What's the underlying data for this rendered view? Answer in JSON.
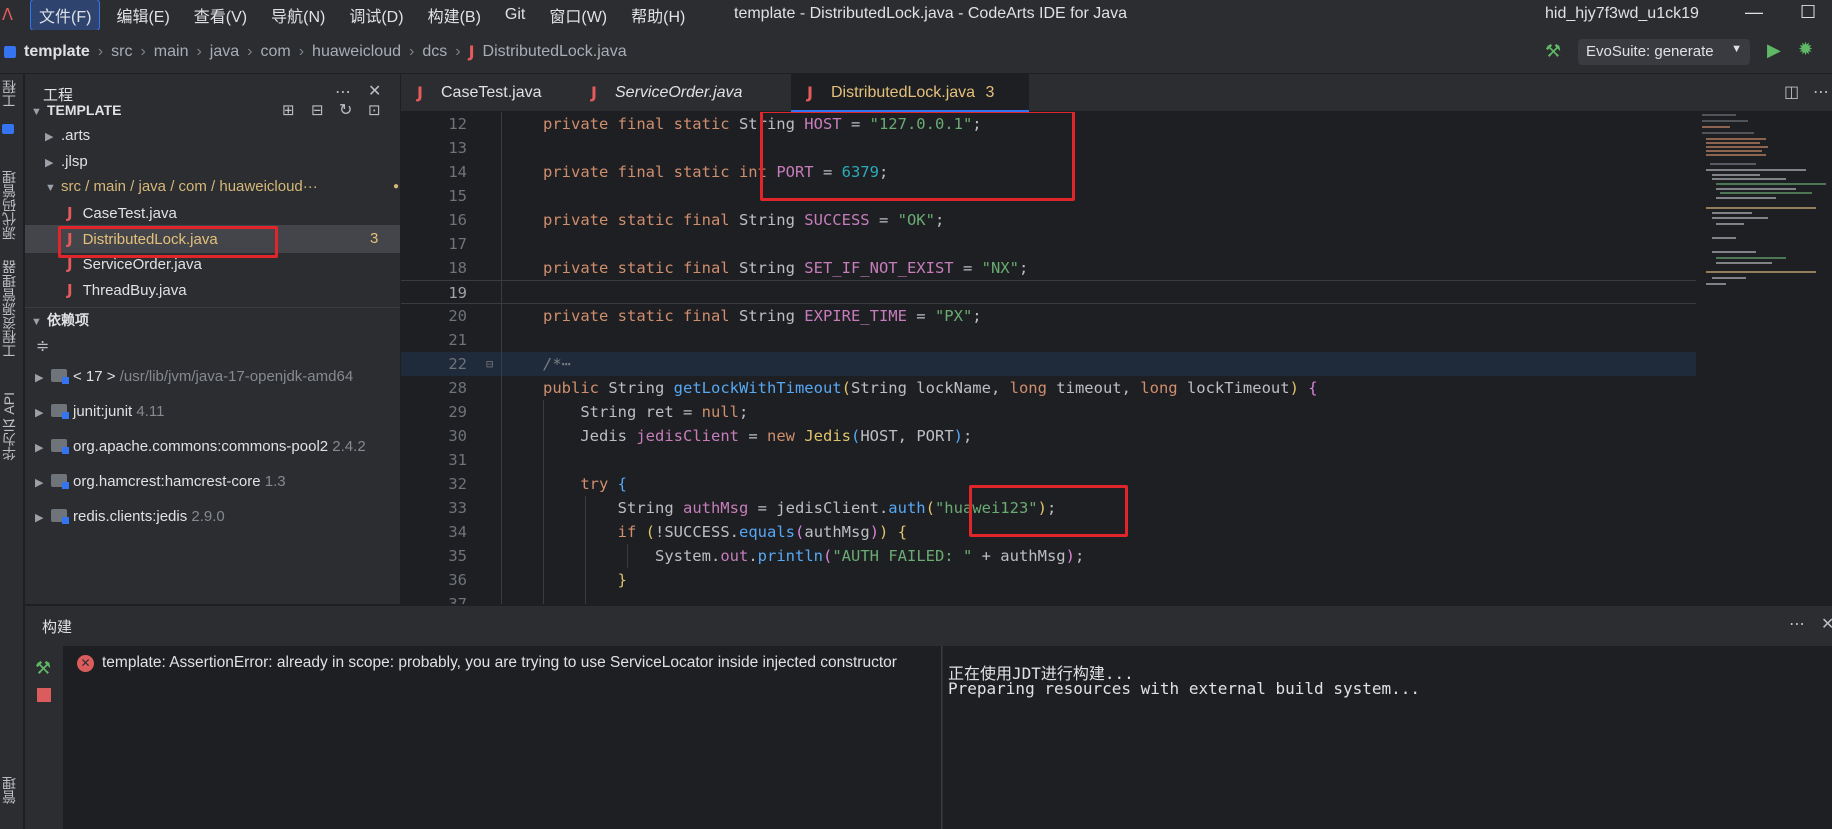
{
  "titlebar": {
    "menu": [
      "文件(F)",
      "编辑(E)",
      "查看(V)",
      "导航(N)",
      "调试(D)",
      "构建(B)",
      "Git",
      "窗口(W)",
      "帮助(H)"
    ],
    "title": "template - DistributedLock.java - CodeArts IDE for Java",
    "user": "hid_hjy7f3wd_u1ck19",
    "minimize": "—",
    "maximize": "☐"
  },
  "breadcrumb": [
    "template",
    "src",
    "main",
    "java",
    "com",
    "huaweicloud",
    "dcs",
    "DistributedLock.java"
  ],
  "toolbar": {
    "evosuite_label": "EvoSuite: generate"
  },
  "left_strip": {
    "project": "工程",
    "source_control": "源代码管理",
    "explorer": "工程资源管理器",
    "api": "华为云 API",
    "manage": "管理"
  },
  "project_panel": {
    "title": "工程",
    "root": "TEMPLATE",
    "items": [
      {
        "label": ".arts"
      },
      {
        "label": ".jlsp"
      },
      {
        "label": "src / main / java / com / huaweicloud···"
      },
      {
        "label": "CaseTest.java"
      },
      {
        "label": "DistributedLock.java",
        "badge": "3"
      },
      {
        "label": "ServiceOrder.java"
      },
      {
        "label": "ThreadBuy.java"
      }
    ],
    "deps_title": "依赖项",
    "deps": [
      {
        "name": "< 17 >",
        "detail": "/usr/lib/jvm/java-17-openjdk-amd64"
      },
      {
        "name": "junit:junit",
        "detail": "4.11"
      },
      {
        "name": "org.apache.commons:commons-pool2",
        "detail": "2.4.2"
      },
      {
        "name": "org.hamcrest:hamcrest-core",
        "detail": "1.3"
      },
      {
        "name": "redis.clients:jedis",
        "detail": "2.9.0"
      }
    ]
  },
  "tabs": [
    {
      "label": "CaseTest.java"
    },
    {
      "label": "ServiceOrder.java"
    },
    {
      "label": "DistributedLock.java",
      "badge": "3"
    }
  ],
  "code": {
    "line_numbers": [
      "12",
      "13",
      "14",
      "15",
      "16",
      "17",
      "18",
      "19",
      "20",
      "21",
      "22",
      "28",
      "29",
      "30",
      "31",
      "32",
      "33",
      "34",
      "35",
      "36",
      "37"
    ]
  },
  "build_panel": {
    "title": "构建",
    "error": "template: AssertionError: already in scope: probably, you are trying to use ServiceLocator inside injected constructor",
    "output": [
      "正在使用JDT进行构建...",
      "Preparing resources with external build system..."
    ]
  }
}
